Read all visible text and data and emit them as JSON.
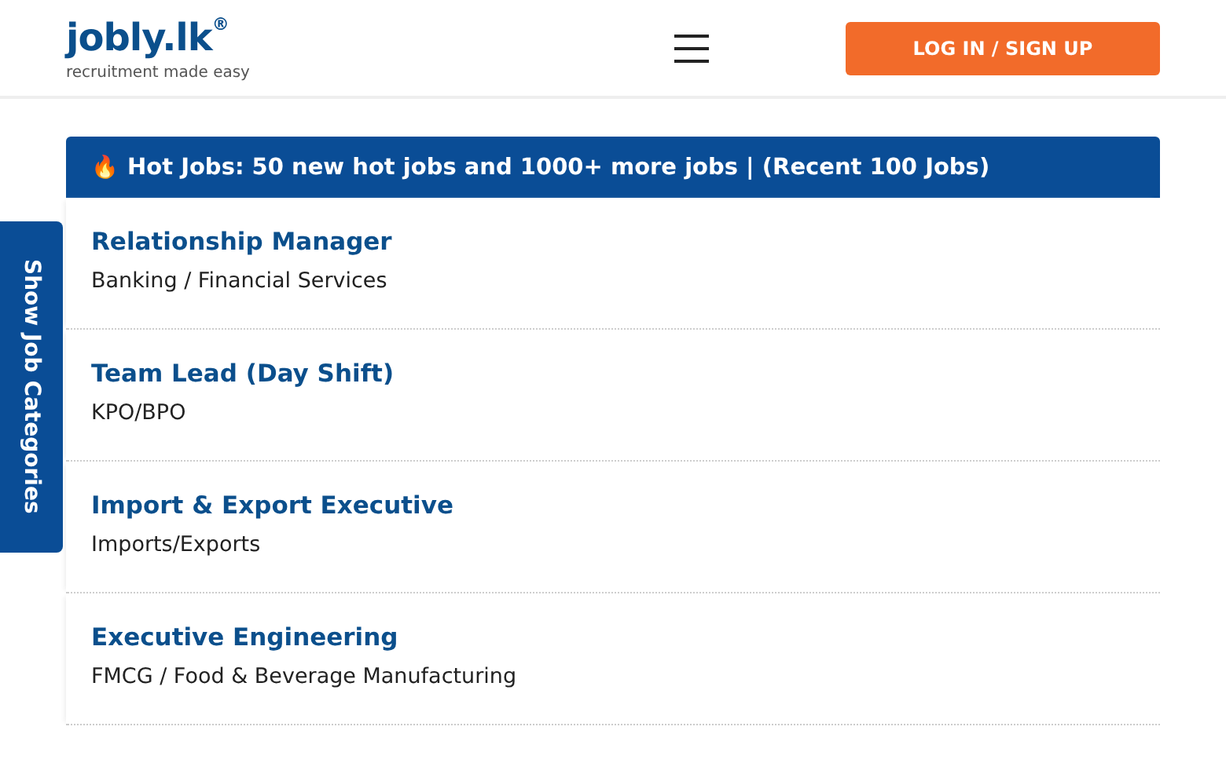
{
  "header": {
    "logo": "jobly.lk",
    "logo_mark": "®",
    "tagline": "recruitment made easy",
    "login_button": "LOG IN / SIGN UP"
  },
  "side_tab": {
    "label": "Show Job Categories"
  },
  "hot_jobs": {
    "icon": "🔥",
    "title": "Hot Jobs: 50 new hot jobs and 1000+ more jobs | (Recent 100 Jobs)"
  },
  "jobs": [
    {
      "title": "Relationship Manager",
      "category": "Banking / Financial Services"
    },
    {
      "title": "Team Lead (Day Shift)",
      "category": "KPO/BPO"
    },
    {
      "title": "Import & Export Executive",
      "category": "Imports/Exports"
    },
    {
      "title": "Executive Engineering",
      "category": "FMCG / Food & Beverage Manufacturing"
    }
  ]
}
